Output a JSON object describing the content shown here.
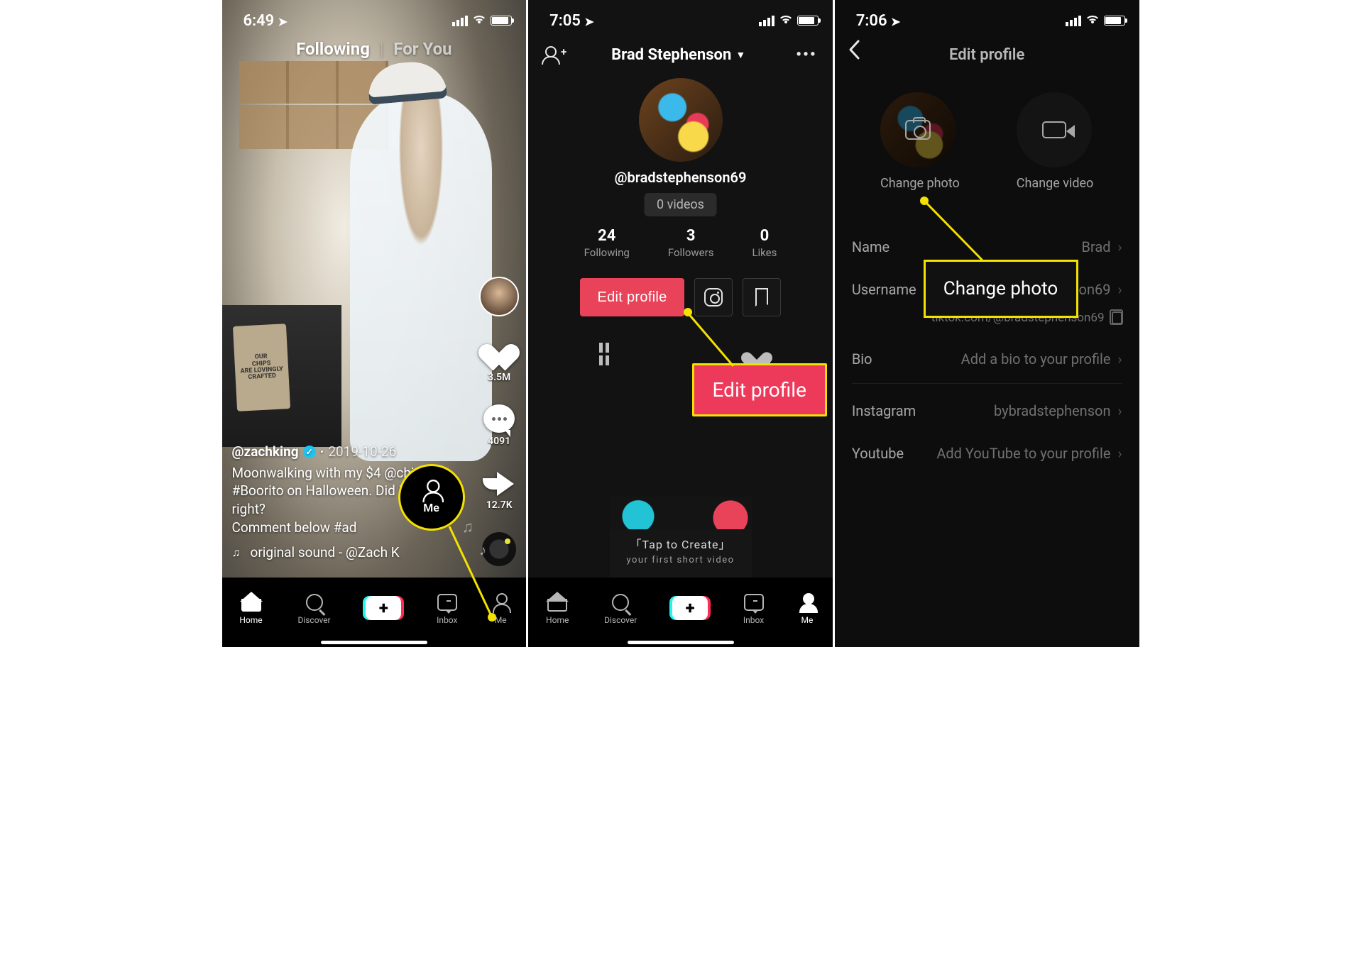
{
  "screen1": {
    "time": "6:49",
    "tabs": {
      "following": "Following",
      "foryou": "For You"
    },
    "sidebar": {
      "like_count": "3.5M",
      "comment_count": "4091",
      "share_count": "12.7K"
    },
    "caption": {
      "username": "@zachking",
      "date": "2019-10-26",
      "text_line1": "Moonwalking with my $4 @chipo",
      "text_line2": "#Boorito on Halloween. Did I do it right?",
      "text_line3": "Comment below #ad",
      "sound": "original sound - @Zach K"
    },
    "chips_bag": "OUR\nCHIPS\nARE LOVINGLY\nCRAFTED",
    "nav": {
      "home": "Home",
      "discover": "Discover",
      "inbox": "Inbox",
      "me": "Me"
    },
    "annotation_me": "Me"
  },
  "screen2": {
    "time": "7:05",
    "title": "Brad Stephenson",
    "handle": "@bradstephenson69",
    "videos_chip": "0 videos",
    "stats": {
      "following": {
        "num": "24",
        "label": "Following"
      },
      "followers": {
        "num": "3",
        "label": "Followers"
      },
      "likes": {
        "num": "0",
        "label": "Likes"
      }
    },
    "edit_button": "Edit profile",
    "create": {
      "line1": "「Tap to Create」",
      "line2": "your first short video"
    },
    "nav": {
      "home": "Home",
      "discover": "Discover",
      "inbox": "Inbox",
      "me": "Me"
    },
    "annotation_edit": "Edit profile"
  },
  "screen3": {
    "time": "7:06",
    "title": "Edit profile",
    "change_photo": "Change photo",
    "change_video": "Change video",
    "rows": {
      "name": {
        "label": "Name",
        "value": "Brad"
      },
      "username": {
        "label": "Username",
        "value": "bradstephenson69"
      },
      "link": "tiktok.com/@bradstephenson69",
      "bio": {
        "label": "Bio",
        "value": "Add a bio to your profile"
      },
      "instagram": {
        "label": "Instagram",
        "value": "bybradstephenson"
      },
      "youtube": {
        "label": "Youtube",
        "value": "Add YouTube to your profile"
      }
    },
    "annotation_cp": "Change photo"
  }
}
